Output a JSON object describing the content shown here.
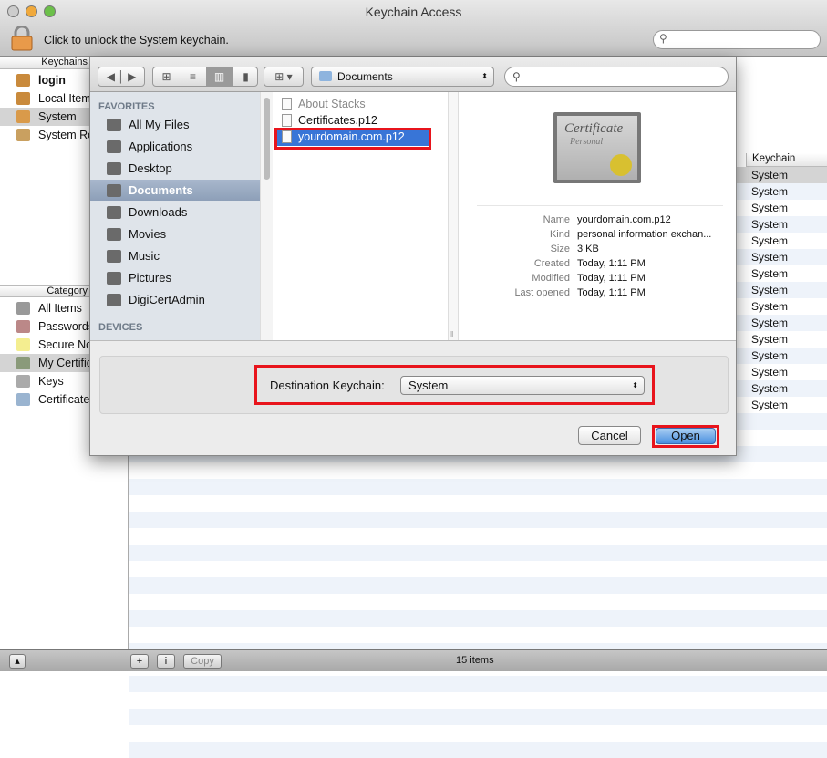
{
  "window": {
    "title": "Keychain Access",
    "unlock_text": "Click to unlock the System keychain.",
    "search_placeholder": ""
  },
  "sidebar": {
    "keychains_header": "Keychains",
    "keychains": [
      {
        "label": "login",
        "bold": true
      },
      {
        "label": "Local Items"
      },
      {
        "label": "System",
        "selected": true
      },
      {
        "label": "System Roots"
      }
    ],
    "category_header": "Category",
    "categories": [
      {
        "label": "All Items"
      },
      {
        "label": "Passwords"
      },
      {
        "label": "Secure Notes"
      },
      {
        "label": "My Certificates",
        "selected": true
      },
      {
        "label": "Keys"
      },
      {
        "label": "Certificates"
      }
    ]
  },
  "list": {
    "keychain_header": "Keychain",
    "rows": [
      "System",
      "System",
      "System",
      "System",
      "System",
      "System",
      "System",
      "System",
      "System",
      "System",
      "System",
      "System",
      "System",
      "System",
      "System"
    ]
  },
  "bottombar": {
    "add": "+",
    "info": "i",
    "copy": "Copy",
    "count": "15 items"
  },
  "dialog": {
    "location": "Documents",
    "search_placeholder": "",
    "favorites_header": "FAVORITES",
    "favorites": [
      {
        "label": "All My Files"
      },
      {
        "label": "Applications"
      },
      {
        "label": "Desktop"
      },
      {
        "label": "Documents",
        "selected": true
      },
      {
        "label": "Downloads"
      },
      {
        "label": "Movies"
      },
      {
        "label": "Music"
      },
      {
        "label": "Pictures"
      },
      {
        "label": "DigiCertAdmin"
      }
    ],
    "devices_header": "DEVICES",
    "files": [
      {
        "label": "About Stacks",
        "dim": true
      },
      {
        "label": "Certificates.p12"
      },
      {
        "label": "yourdomain.com.p12",
        "selected": true
      }
    ],
    "preview": {
      "icon_text": [
        "Certificate",
        "Personal"
      ],
      "fields": [
        {
          "label": "Name",
          "value": "yourdomain.com.p12"
        },
        {
          "label": "Kind",
          "value": "personal information exchan..."
        },
        {
          "label": "Size",
          "value": "3 KB"
        },
        {
          "label": "Created",
          "value": "Today, 1:11 PM"
        },
        {
          "label": "Modified",
          "value": "Today, 1:11 PM"
        },
        {
          "label": "Last opened",
          "value": "Today, 1:11 PM"
        }
      ]
    },
    "destination_label": "Destination Keychain:",
    "destination_value": "System",
    "cancel": "Cancel",
    "open": "Open"
  },
  "colors": {
    "highlight": "#e8141c",
    "selection": "#3875d7"
  }
}
